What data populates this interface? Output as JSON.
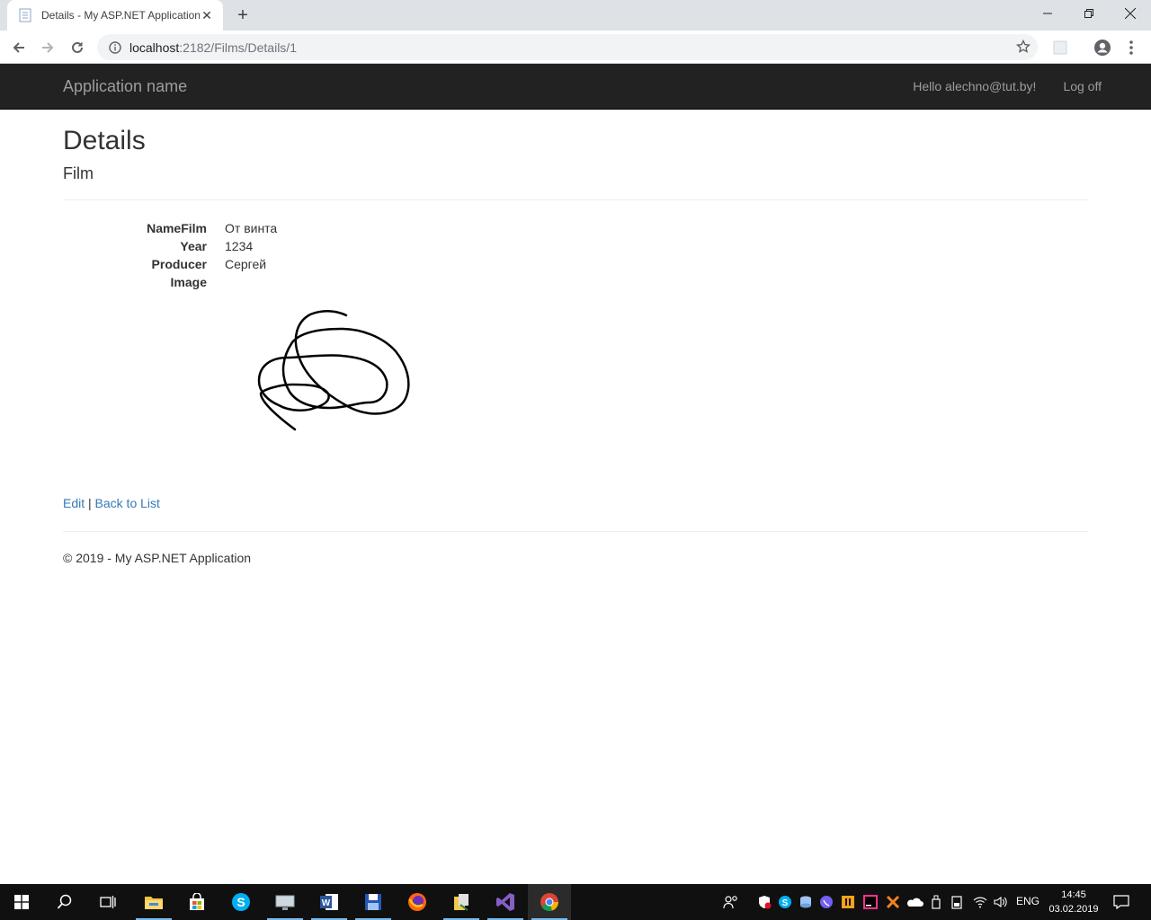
{
  "browser": {
    "tab_title": "Details - My ASP.NET Application",
    "url_host": "localhost",
    "url_path": ":2182/Films/Details/1"
  },
  "navbar": {
    "brand": "Application name",
    "greeting": "Hello alechno@tut.by!",
    "logoff": "Log off"
  },
  "page": {
    "title": "Details",
    "subtitle": "Film",
    "fields": [
      {
        "label": "NameFilm",
        "value": "От винта"
      },
      {
        "label": "Year",
        "value": "1234"
      },
      {
        "label": "Producer",
        "value": "Сергей"
      },
      {
        "label": "Image",
        "value": ""
      }
    ],
    "edit_link": "Edit",
    "separator": "|",
    "back_link": "Back to List",
    "footer": "© 2019 - My ASP.NET Application"
  },
  "taskbar": {
    "lang": "ENG",
    "time": "14:45",
    "date": "03.02.2019"
  },
  "colors": {
    "navbar_bg": "#222222",
    "link": "#337ab7"
  }
}
